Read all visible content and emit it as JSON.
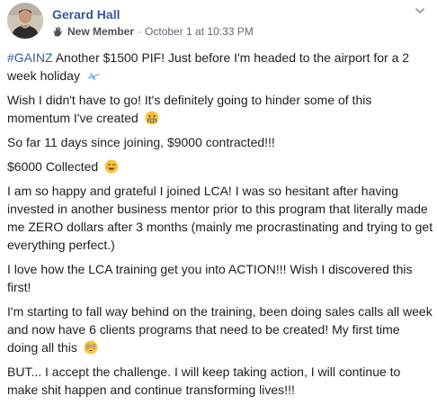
{
  "post": {
    "author": "Gerard Hall",
    "badge": "New Member",
    "separator": "·",
    "timestamp": "October 1 at 10:33 PM",
    "menu_icon": "chevron-down-icon",
    "colors": {
      "link": "#385898",
      "meta": "#616770",
      "text": "#1c1e21"
    },
    "paragraphs": {
      "p1": {
        "hashtag": "#GAINZ",
        "text": " Another $1500 PIF! Just before I'm headed to the airport for a 2 week holiday",
        "emoji": "airplane-emoji"
      },
      "p2": {
        "text": "Wish I didn't have to go! It's definitely going to hinder some of this momentum I've created",
        "emoji": "grimacing-face-emoji"
      },
      "p3": {
        "text": "So far 11 days since joining, $9000 contracted!!!"
      },
      "p4": {
        "text": "$6000 Collected",
        "emoji": "smiling-face-emoji"
      },
      "p5": {
        "text": "I am so happy and grateful I joined LCA! I was so hesitant after having invested in another business mentor prior to this program that literally made me ZERO dollars after 3 months (mainly me procrastinating and trying to get everything perfect.)"
      },
      "p6": {
        "text": "I love how the LCA training get you into ACTION!!! Wish I discovered this first!"
      },
      "p7": {
        "text": "I'm starting to fall way behind on the training, been doing sales calls all week and now have 6 clients programs that need to be created! My first time doing all this",
        "emoji": "flushed-face-emoji"
      },
      "p8": {
        "text": "BUT... I accept the challenge. I will keep taking action, I will continue to make shit happen and continue transforming lives!!!"
      }
    }
  }
}
